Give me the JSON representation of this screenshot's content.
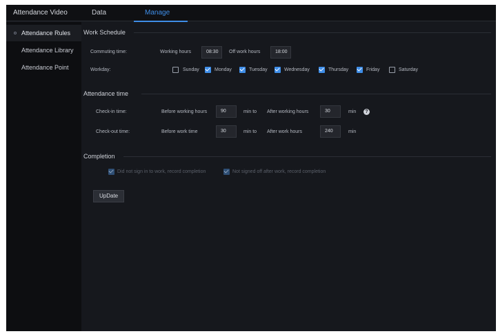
{
  "app": {
    "title": "Attendance Video"
  },
  "tabs": [
    {
      "label": "Data"
    },
    {
      "label": "Manage"
    }
  ],
  "sidebar": {
    "items": [
      {
        "label": "Attendance Rules"
      },
      {
        "label": "Attendance Library"
      },
      {
        "label": "Attendance Point"
      }
    ]
  },
  "work_schedule": {
    "title": "Work Schedule",
    "commuting_label": "Commuting time:",
    "working_hours_label": "Working hours",
    "working_hours_value": "08:30",
    "off_work_label": "Off work hours",
    "off_work_value": "18:00",
    "workday_label": "Workday:",
    "days": [
      {
        "label": "Sunday",
        "checked": false
      },
      {
        "label": "Monday",
        "checked": true
      },
      {
        "label": "Tuesday",
        "checked": true
      },
      {
        "label": "Wednesday",
        "checked": true
      },
      {
        "label": "Thursday",
        "checked": true
      },
      {
        "label": "Friday",
        "checked": true
      },
      {
        "label": "Saturday",
        "checked": false
      }
    ]
  },
  "attendance_time": {
    "title": "Attendance time",
    "checkin_label": "Check-in time:",
    "checkin_before_label": "Before working hours",
    "checkin_before_value": "90",
    "checkin_min_to": "min  to",
    "checkin_after_label": "After working hours",
    "checkin_after_value": "30",
    "checkin_min": "min",
    "checkout_label": "Check-out time:",
    "checkout_before_label": "Before work time",
    "checkout_before_value": "30",
    "checkout_min_to": "min  to",
    "checkout_after_label": "After work hours",
    "checkout_after_value": "240",
    "checkout_min": "min",
    "help_glyph": "?"
  },
  "completion": {
    "title": "Completion",
    "option1": "Did not sign in to work, record completion",
    "option2": "Not signed off after work, record completion"
  },
  "update_button": {
    "label": "UpDate"
  },
  "colors": {
    "accent": "#3f8ee8",
    "background": "#16181d",
    "sidebar": "#0d0e11"
  }
}
